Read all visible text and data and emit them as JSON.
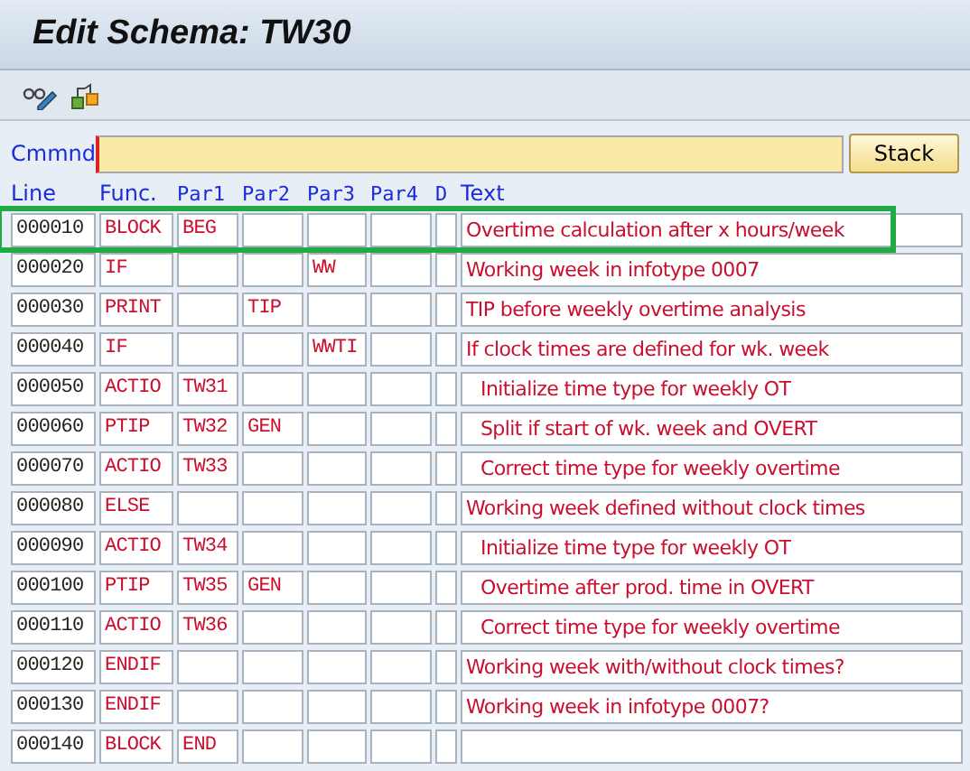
{
  "window": {
    "title": "Edit Schema: TW30"
  },
  "command": {
    "label": "Cmmnd",
    "button": "Stack"
  },
  "columns": [
    "Line",
    "Func.",
    "Par1",
    "Par2",
    "Par3",
    "Par4",
    "D",
    "Text"
  ],
  "rows": [
    {
      "line": "000010",
      "func": "BLOCK",
      "par1": "BEG",
      "text": "Overtime calculation after x hours/week",
      "indented": false,
      "highlighted": true
    },
    {
      "line": "000020",
      "func": "IF",
      "par3": "WW",
      "text": "Working week in infotype 0007",
      "indented": false,
      "highlighted": false
    },
    {
      "line": "000030",
      "func": "PRINT",
      "par2": "TIP",
      "text": "TIP before weekly overtime analysis",
      "indented": false,
      "highlighted": false
    },
    {
      "line": "000040",
      "func": "IF",
      "par3": "WWTI",
      "text": "If clock times are defined for wk. week",
      "indented": false,
      "highlighted": false
    },
    {
      "line": "000050",
      "func": "ACTIO",
      "par1": "TW31",
      "text": "Initialize time type for weekly OT",
      "indented": true,
      "highlighted": false
    },
    {
      "line": "000060",
      "func": "PTIP",
      "par1": "TW32",
      "par2": "GEN",
      "text": "Split if start of wk. week and OVERT",
      "indented": true,
      "highlighted": false
    },
    {
      "line": "000070",
      "func": "ACTIO",
      "par1": "TW33",
      "text": "Correct time type for weekly overtime",
      "indented": true,
      "highlighted": false
    },
    {
      "line": "000080",
      "func": "ELSE",
      "text": "Working week defined without clock times",
      "indented": false,
      "highlighted": false
    },
    {
      "line": "000090",
      "func": "ACTIO",
      "par1": "TW34",
      "text": "Initialize time type for weekly OT",
      "indented": true,
      "highlighted": false
    },
    {
      "line": "000100",
      "func": "PTIP",
      "par1": "TW35",
      "par2": "GEN",
      "text": "Overtime after prod. time in OVERT",
      "indented": true,
      "highlighted": false
    },
    {
      "line": "000110",
      "func": "ACTIO",
      "par1": "TW36",
      "text": "Correct time type for weekly overtime",
      "indented": true,
      "highlighted": false
    },
    {
      "line": "000120",
      "func": "ENDIF",
      "text": "Working week with/without clock times?",
      "indented": false,
      "highlighted": false
    },
    {
      "line": "000130",
      "func": "ENDIF",
      "text": "Working week in infotype 0007?",
      "indented": false,
      "highlighted": false
    },
    {
      "line": "000140",
      "func": "BLOCK",
      "par1": "END",
      "highlighted": false
    }
  ]
}
